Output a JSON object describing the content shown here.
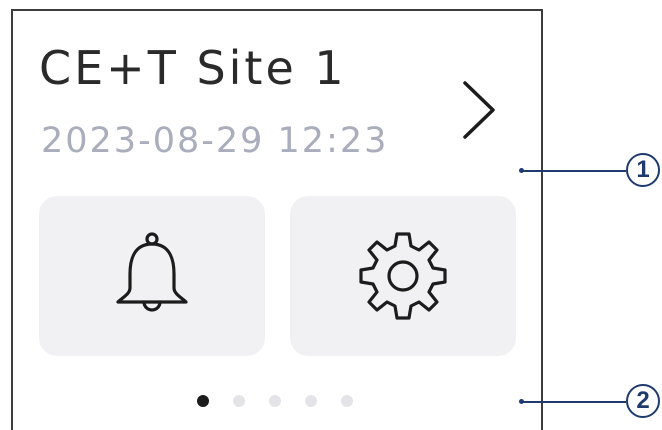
{
  "device": {
    "site_name": "CE+T Site 1",
    "datetime": "2023-08-29 12:23",
    "chevron_icon": "chevron-right-icon"
  },
  "tiles": [
    {
      "name": "alarms",
      "icon": "bell-icon"
    },
    {
      "name": "settings",
      "icon": "gear-icon"
    }
  ],
  "pagination": {
    "total": 5,
    "active": 1
  },
  "callouts": [
    {
      "label": "1"
    },
    {
      "label": "2"
    }
  ],
  "colors": {
    "title_text": "#2a2a2a",
    "datetime_text": "#a9adbc",
    "tile_background": "#f1f1f3",
    "dot_active": "#1d1d1d",
    "dot_inactive": "#e4e4e8",
    "callout": "#1f3a6e",
    "screen_border": "#3c3c3c"
  }
}
